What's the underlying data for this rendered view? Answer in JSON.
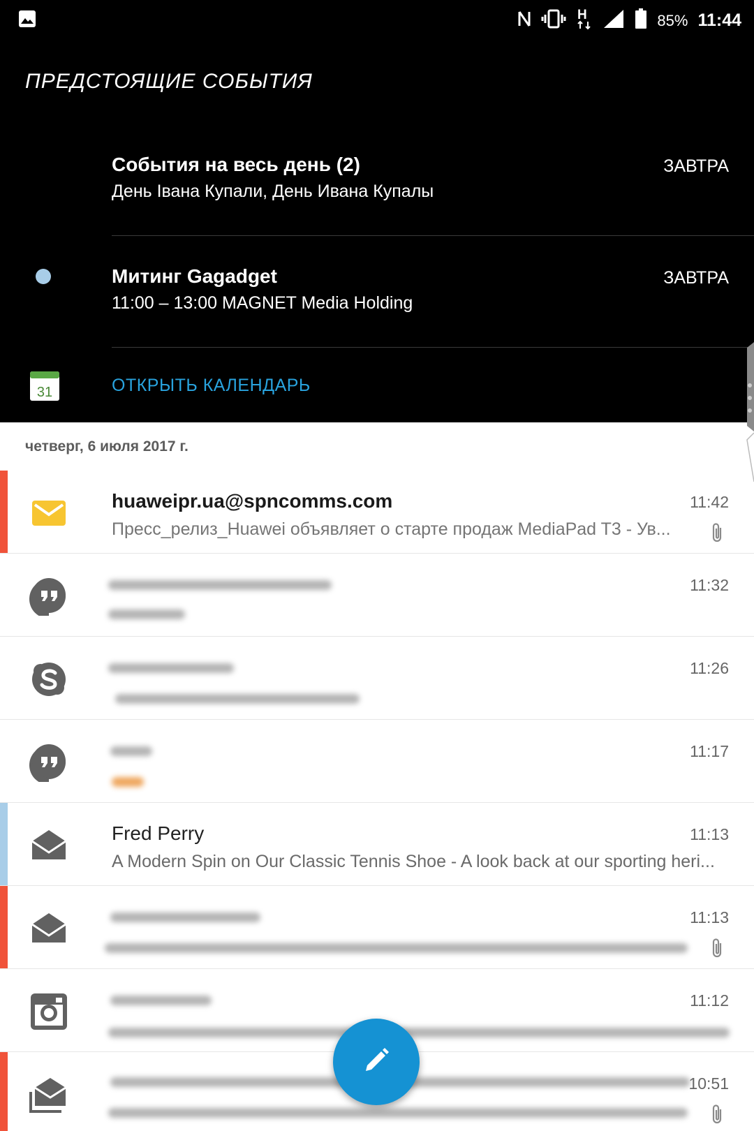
{
  "status_bar": {
    "battery": "85%",
    "time": "11:44",
    "network": "H",
    "icons": [
      "image-icon",
      "nfc-icon",
      "vibrate-icon",
      "network-arrows-icon",
      "signal-icon",
      "battery-icon"
    ]
  },
  "upcoming": {
    "title": "ПРЕДСТОЯЩИЕ  СОБЫТИЯ",
    "events": [
      {
        "title": "События на весь день (2)",
        "subtitle": "День Івана Купали, День Ивана Купалы",
        "when": "ЗАВТРА"
      },
      {
        "title": "Митинг Gagadget",
        "subtitle": "11:00 – 13:00  MAGNET Media Holding",
        "when": "ЗАВТРА",
        "dot_color": "#a8cde8"
      }
    ],
    "open_calendar": "ОТКРЫТЬ КАЛЕНДАРЬ",
    "calendar_icon_day": "31"
  },
  "date_header": "четверг, 6 июля 2017 г.",
  "notifications": [
    {
      "app": "email",
      "icon": "email-icon",
      "title": "huaweipr.ua@spncomms.com",
      "snippet": "Пресс_релиз_Huawei объявляет о старте продаж MediaPad T3  - Ув...",
      "time": "11:42",
      "attachment": true,
      "stripe": "#f0533a"
    },
    {
      "app": "hangouts",
      "icon": "hangouts-icon",
      "time": "11:32",
      "blurred": true
    },
    {
      "app": "skype",
      "icon": "skype-icon",
      "time": "11:26",
      "blurred": true
    },
    {
      "app": "hangouts",
      "icon": "hangouts-icon",
      "time": "11:17",
      "blurred": true
    },
    {
      "app": "email",
      "icon": "open-envelope-icon",
      "title": "Fred Perry",
      "snippet": "A Modern Spin on Our Classic Tennis Shoe - A look back at our sporting heri...",
      "time": "11:13",
      "stripe": "#a8cde8"
    },
    {
      "app": "email",
      "icon": "open-envelope-icon",
      "time": "11:13",
      "attachment": true,
      "blurred": true,
      "stripe": "#f0533a"
    },
    {
      "app": "instagram",
      "icon": "instagram-icon",
      "time": "11:12",
      "blurred": true
    },
    {
      "app": "email",
      "icon": "stacked-envelope-icon",
      "time": "10:51",
      "attachment": true,
      "blurred": true,
      "stripe": "#f0533a"
    }
  ],
  "fab_icon": "pencil-icon"
}
